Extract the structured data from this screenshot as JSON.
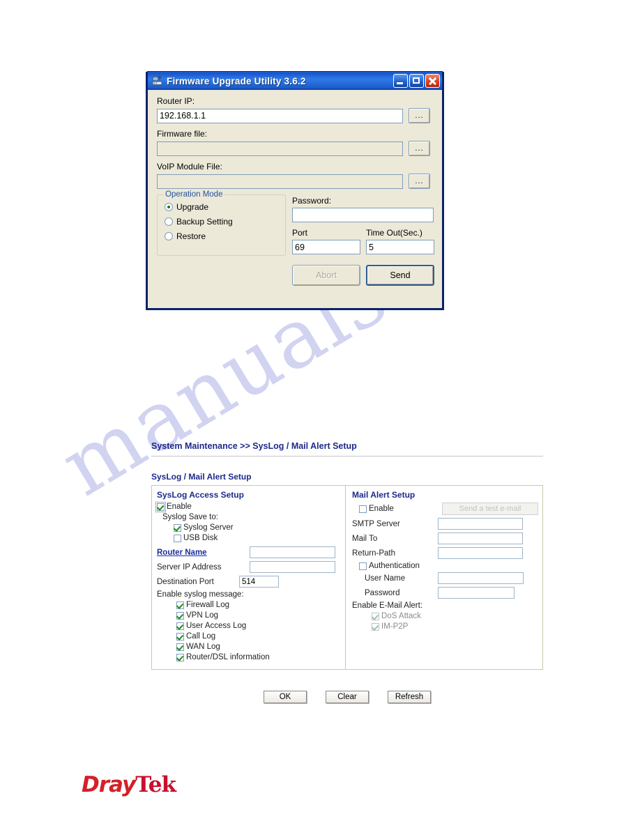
{
  "watermark": {
    "text": "manualshive.com"
  },
  "dialog": {
    "title": "Firmware Upgrade Utility 3.6.2",
    "icon": "router-upgrade-icon",
    "window_buttons": {
      "minimize": "minimize-icon",
      "maximize": "maximize-icon",
      "close": "close-icon"
    },
    "fields": [
      {
        "label": "Router IP:",
        "value": "192.168.1.1",
        "browse": "...",
        "disabled": false
      },
      {
        "label": "Firmware file:",
        "value": "",
        "browse": "...",
        "disabled": true
      },
      {
        "label": "VoIP Module File:",
        "value": "",
        "browse": "...",
        "disabled": true
      }
    ],
    "operation_mode": {
      "title": "Operation Mode",
      "options": [
        {
          "label": "Upgrade",
          "selected": true
        },
        {
          "label": "Backup Setting",
          "selected": false
        },
        {
          "label": "Restore",
          "selected": false
        }
      ]
    },
    "password": {
      "label": "Password:",
      "value": ""
    },
    "port": {
      "label": "Port",
      "value": "69"
    },
    "timeout": {
      "label": "Time Out(Sec.)",
      "value": "5"
    },
    "abort_button": "Abort",
    "send_button": "Send"
  },
  "webui": {
    "breadcrumb_root": "System Maintenance",
    "breadcrumb_sep": ">>",
    "breadcrumb_leaf": "SysLog / Mail Alert Setup",
    "panel_title": "SysLog / Mail Alert Setup",
    "syslog": {
      "heading": "SysLog Access Setup",
      "enable": {
        "label": "Enable",
        "checked": true
      },
      "save_to_label": "Syslog Save to:",
      "save_to": [
        {
          "label": "Syslog Server",
          "checked": true
        },
        {
          "label": "USB Disk",
          "checked": false
        }
      ],
      "router_name_label": "Router Name",
      "router_name_value": "",
      "server_ip_label": "Server IP Address",
      "server_ip_value": "",
      "dest_port_label": "Destination Port",
      "dest_port_value": "514",
      "enable_msg_label": "Enable syslog message:",
      "messages": [
        {
          "label": "Firewall Log",
          "checked": true
        },
        {
          "label": "VPN Log",
          "checked": true
        },
        {
          "label": "User Access Log",
          "checked": true
        },
        {
          "label": "Call Log",
          "checked": true
        },
        {
          "label": "WAN Log",
          "checked": true
        },
        {
          "label": "Router/DSL information",
          "checked": true
        }
      ]
    },
    "mail": {
      "heading": "Mail Alert Setup",
      "enable": {
        "label": "Enable",
        "checked": false
      },
      "test_button": "Send a test e-mail",
      "smtp_label": "SMTP Server",
      "smtp_value": "",
      "mail_to_label": "Mail To",
      "mail_to_value": "",
      "return_path_label": "Return-Path",
      "return_path_value": "",
      "auth": {
        "label": "Authentication",
        "checked": false
      },
      "user_name_label": "User Name",
      "user_name_value": "",
      "password_label": "Password",
      "password_value": "",
      "enable_alert_label": "Enable E-Mail Alert:",
      "alerts": [
        {
          "label": "DoS Attack",
          "checked": true
        },
        {
          "label": "IM-P2P",
          "checked": true
        }
      ]
    },
    "buttons": [
      "OK",
      "Clear",
      "Refresh"
    ]
  },
  "logo": {
    "part1": "Dray",
    "part2": "Tek",
    "color": "#cf1f27"
  }
}
